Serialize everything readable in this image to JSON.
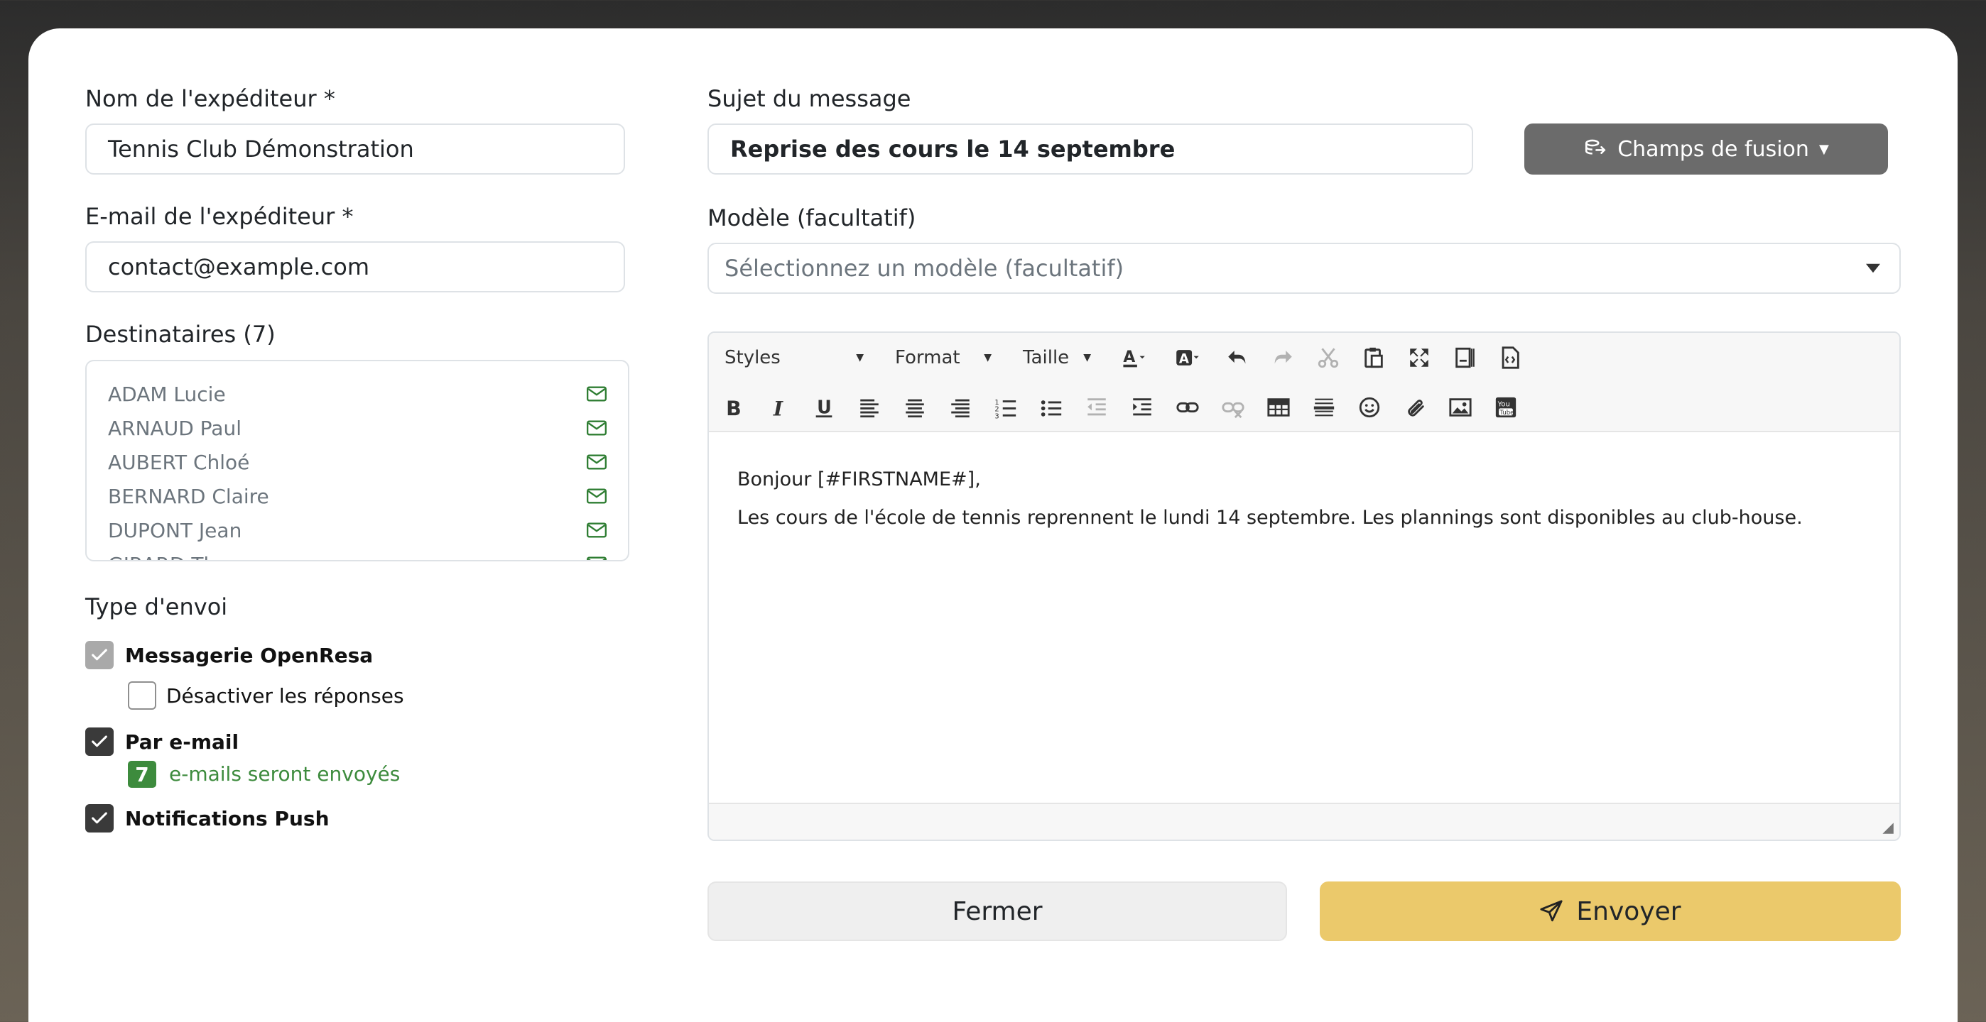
{
  "form": {
    "sender_name_label": "Nom de l'expéditeur *",
    "sender_name_value": "Tennis Club Démonstration",
    "sender_email_label": "E-mail de l'expéditeur *",
    "sender_email_value": "contact@example.com",
    "recipients_label": "Destinataires (7)",
    "subject_label": "Sujet du message",
    "subject_value": "Reprise des cours le 14 septembre",
    "merge_fields_label": "Champs de fusion",
    "template_label": "Modèle (facultatif)",
    "template_placeholder": "Sélectionnez un modèle (facultatif)"
  },
  "recipients": [
    "ADAM Lucie",
    "ARNAUD Paul",
    "AUBERT Chloé",
    "BERNARD Claire",
    "DUPONT Jean",
    "GIRARD Thomas"
  ],
  "send_type": {
    "label": "Type d'envoi",
    "messaging_label": "Messagerie OpenResa",
    "disable_replies_label": "Désactiver les réponses",
    "email_label": "Par e-mail",
    "email_count": "7",
    "email_count_text": "e-mails seront envoyés",
    "push_label": "Notifications Push",
    "messaging_checked": true,
    "disable_replies_checked": false,
    "email_checked": true,
    "push_checked": true
  },
  "editor": {
    "styles_label": "Styles",
    "format_label": "Format",
    "size_label": "Taille",
    "line1": "Bonjour [#FIRSTNAME#],",
    "line2": "Les cours de l'école de tennis reprennent le lundi 14 septembre. Les plannings sont disponibles au club-house."
  },
  "actions": {
    "close_label": "Fermer",
    "send_label": "Envoyer"
  },
  "colors": {
    "accent_send": "#ebc96b",
    "merge_button": "#6b6b6b",
    "badge_green": "#3d8b3d",
    "mail_icon_green": "#2e7d32"
  }
}
